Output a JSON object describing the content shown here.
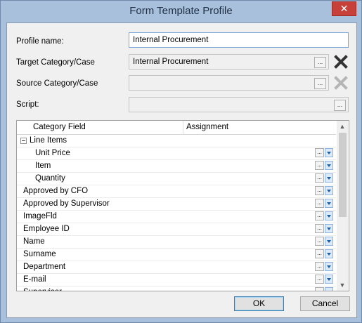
{
  "window": {
    "title": "Form Template Profile",
    "close_glyph": "✕"
  },
  "profile_name": {
    "label": "Profile name:",
    "value": "Internal Procurement"
  },
  "target": {
    "label": "Target Category/Case",
    "value": "Internal Procurement",
    "dots": "..."
  },
  "source": {
    "label": "Source Category/Case",
    "value": "",
    "dots": "..."
  },
  "script": {
    "label": "Script:",
    "value": "",
    "dots": "..."
  },
  "grid": {
    "columns": [
      "Category Field",
      "Assignment"
    ],
    "rows": [
      {
        "label": "Line Items",
        "level": 0,
        "expandable": true
      },
      {
        "label": "Unit Price",
        "level": 2
      },
      {
        "label": "Item",
        "level": 2
      },
      {
        "label": "Quantity",
        "level": 2
      },
      {
        "label": "Approved by CFO",
        "level": 1
      },
      {
        "label": "Approved by Supervisor",
        "level": 1
      },
      {
        "label": "ImageFld",
        "level": 1
      },
      {
        "label": "Employee ID",
        "level": 1
      },
      {
        "label": "Name",
        "level": 1
      },
      {
        "label": "Surname",
        "level": 1
      },
      {
        "label": "Department",
        "level": 1
      },
      {
        "label": "E-mail",
        "level": 1
      },
      {
        "label": "Supervisor",
        "level": 1
      }
    ],
    "row_button": "..."
  },
  "buttons": {
    "ok": "OK",
    "cancel": "Cancel"
  },
  "colors": {
    "accent": "#3c7fb1",
    "close": "#c7413a",
    "clear_enabled": "#333333",
    "clear_disabled": "#b5b5b5"
  }
}
